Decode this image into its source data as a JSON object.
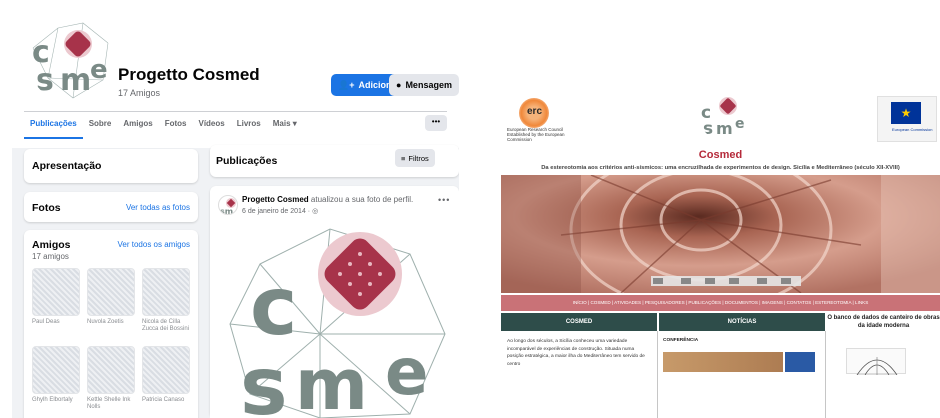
{
  "facebook": {
    "page_name": "Progetto Cosmed",
    "friends_count": "17 Amigos",
    "add_button": "Adicionar",
    "message_button": "Mensagem",
    "tabs": [
      {
        "label": "Publicações",
        "active": true
      },
      {
        "label": "Sobre",
        "active": false
      },
      {
        "label": "Amigos",
        "active": false
      },
      {
        "label": "Fotos",
        "active": false
      },
      {
        "label": "Vídeos",
        "active": false
      },
      {
        "label": "Livros",
        "active": false
      },
      {
        "label": "Mais ▾",
        "active": false
      }
    ],
    "more_button": "•••",
    "intro_title": "Apresentação",
    "photos_title": "Fotos",
    "photos_link": "Ver todas as fotos",
    "friends_title": "Amigos",
    "friends_link": "Ver todos os amigos",
    "friends_subtitle": "17 amigos",
    "friends": [
      {
        "name": "Paul Deas"
      },
      {
        "name": "Nuvola Zoetis"
      },
      {
        "name": "Nicola de Cilla Zucca dei Bossini"
      },
      {
        "name": "Ghylh Elbortaly"
      },
      {
        "name": "Kettle Shelle Ink Nolls"
      },
      {
        "name": "Patricia Canaso"
      }
    ],
    "posts_title": "Publicações",
    "filter_button": "Filtros",
    "post": {
      "author": "Progetto Cosmed",
      "action": "atualizou a sua foto de perfil.",
      "date": "6 de janeiro de 2014 · ",
      "menu": "•••"
    },
    "colors": {
      "accent": "#1b74e4",
      "bg": "#f0f2f5"
    }
  },
  "cosmed_site": {
    "erc_logo_text": "erc",
    "erc_caption": "European Research Council Established by the European Commission",
    "eu_caption": "European Commission",
    "title": "Cosmed",
    "subtitle": "Da estereotomia aos critérios anti-sísmicos: uma encruzilhada de experimentos de design. Sicília e Mediterrâneo (século XII-XVIII)",
    "nav": "INÍCIO | COSMED | ATIVIDADES | PESQUISADORES | PUBLICAÇÕES | DOCUMENTOS | IMAGENS | CONTATOS | ESTEREOTOMIA | LINKS",
    "columns": [
      {
        "heading": "COSMED"
      },
      {
        "heading": "NOTÍCIAS"
      },
      {
        "heading": "O banco de dados de canteiro de obras da idade moderna"
      }
    ],
    "cosmed_text": "Ao longo dos séculos, a Sicília conheceu uma variedade incomparável de experiências de construção. Situada numa posição estratégica, a maior ilha do Mediterrâneo tem servido de centro",
    "news_label": "CONFERÊNCIA",
    "colors": {
      "title": "#b52a3a",
      "nav": "#c97277",
      "column_head": "#2e4d4a"
    }
  }
}
